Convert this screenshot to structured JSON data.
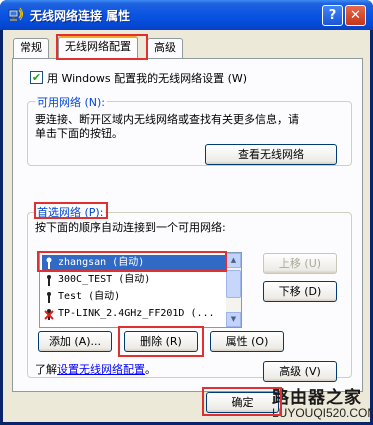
{
  "window": {
    "title": "无线网络连接 属性",
    "help_button": "?",
    "close_button": "✕"
  },
  "tabs": [
    {
      "label": "常规"
    },
    {
      "label": "无线网络配置"
    },
    {
      "label": "高级"
    }
  ],
  "use_windows": {
    "checked": true,
    "check_glyph": "✔",
    "label": "用 Windows 配置我的无线网络设置 (W)"
  },
  "available": {
    "title": "可用网络 (N):",
    "description_line1": "要连接、断开区域内无线网络或查找有关更多信息，请",
    "description_line2": "单击下面的按钮。",
    "view_button": "查看无线网络"
  },
  "preferred": {
    "title": "首选网络 (P):",
    "description": "按下面的顺序自动连接到一个可用网络:",
    "networks": [
      {
        "name": "zhangsan (自动)",
        "selected": true
      },
      {
        "name": "300C_TEST (自动)",
        "selected": false
      },
      {
        "name": "Test (自动)",
        "selected": false
      },
      {
        "name": "TP-LINK_2.4GHz_FF201D (...",
        "selected": false
      }
    ],
    "move_up": "上移 (U)",
    "move_down": "下移 (D)",
    "add": "添加 (A)...",
    "remove": "删除 (R)",
    "properties": "属性 (O)"
  },
  "learn_more": {
    "prefix": "了解",
    "link": "设置无线网络配置",
    "suffix": "。"
  },
  "advanced_button": "高级 (V)",
  "ok_button": "确定",
  "watermark": {
    "title": "路由器之家",
    "url": "LUYOUQI520.COM"
  }
}
